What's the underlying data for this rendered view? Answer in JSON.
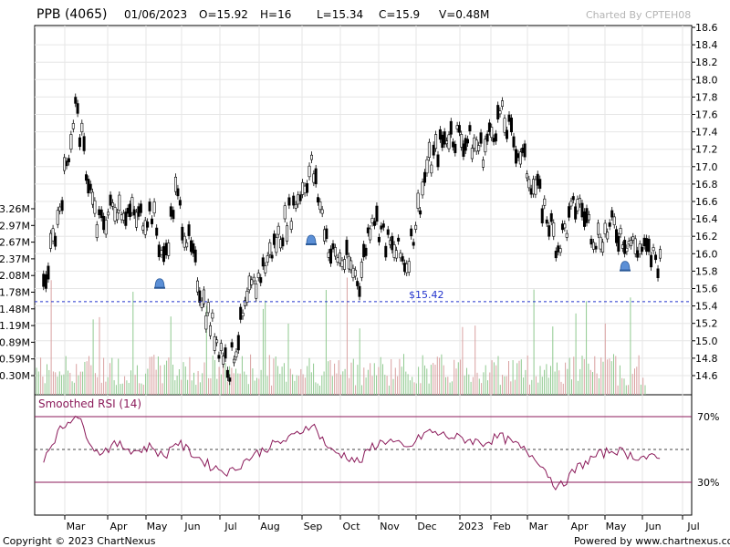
{
  "header": {
    "title": "PPB (4065)",
    "date": "01/06/2023",
    "open": "O=15.92",
    "high": "H=16",
    "low": "L=15.34",
    "close": "C=15.9",
    "volume": "V=0.48M",
    "credit": "Charted By CPTEH08"
  },
  "footer": {
    "copyright": "Copyright © 2023 ChartNexus",
    "powered": "Powered by www.chartnexus.com"
  },
  "colors": {
    "up_candle": "#ffffff",
    "down_candle": "#000000",
    "volume_up": "#8fc98f",
    "volume_down": "#d9a0a0",
    "rsi_line": "#8b1a5a",
    "rsi_bands": "#8b1a5a",
    "price_line": "#2233cc",
    "alert_icon": "#5b8fd6"
  },
  "chart_data": [
    {
      "type": "candlestick",
      "title": "PPB (4065)",
      "ylim": [
        14.4,
        18.6
      ],
      "y_ticks": [
        "18.6",
        "18.4",
        "18.2",
        "18.0",
        "17.8",
        "17.6",
        "17.4",
        "17.2",
        "17.0",
        "16.8",
        "16.6",
        "16.4",
        "16.2",
        "16.0",
        "15.8",
        "15.6",
        "15.4",
        "15.2",
        "15.0",
        "14.8",
        "14.6"
      ],
      "x_ticks": [
        "Mar",
        "Apr",
        "May",
        "Jun",
        "Jul",
        "Aug",
        "Sep",
        "Oct",
        "Nov",
        "Dec",
        "2023",
        "Feb",
        "Mar",
        "Apr",
        "May",
        "Jun",
        "Jul"
      ],
      "reference_line": {
        "label": "$15.42",
        "value": 15.45
      },
      "alerts": [
        {
          "month": "May",
          "price": 15.65
        },
        {
          "month": "Sep",
          "price": 16.15
        },
        {
          "month": "May",
          "price": 15.85
        }
      ],
      "close_path": [
        [
          "Feb",
          15.6
        ],
        [
          "Feb",
          16.4
        ],
        [
          "Mar",
          17.7
        ],
        [
          "Mar",
          16.3
        ],
        [
          "Apr",
          16.6
        ],
        [
          "Apr",
          16.4
        ],
        [
          "May",
          16.5
        ],
        [
          "May",
          15.9
        ],
        [
          "May",
          16.7
        ],
        [
          "Jun",
          16.0
        ],
        [
          "Jun",
          15.2
        ],
        [
          "Jul",
          14.7
        ],
        [
          "Jul",
          15.5
        ],
        [
          "Aug",
          16.0
        ],
        [
          "Aug",
          16.5
        ],
        [
          "Sep",
          17.0
        ],
        [
          "Sep",
          16.0
        ],
        [
          "Oct",
          15.9
        ],
        [
          "Oct",
          15.7
        ],
        [
          "Oct",
          16.5
        ],
        [
          "Nov",
          16.1
        ],
        [
          "Nov",
          15.9
        ],
        [
          "Dec",
          17.0
        ],
        [
          "Dec",
          17.4
        ],
        [
          "2023",
          17.3
        ],
        [
          "2023",
          17.2
        ],
        [
          "Feb",
          17.6
        ],
        [
          "Feb",
          17.2
        ],
        [
          "Mar",
          16.7
        ],
        [
          "Mar",
          16.1
        ],
        [
          "Apr",
          16.6
        ],
        [
          "Apr",
          16.2
        ],
        [
          "May",
          16.3
        ],
        [
          "May",
          16.1
        ],
        [
          "Jun",
          15.9
        ]
      ],
      "volume_axis": {
        "ticks": [
          "3.26M",
          "2.97M",
          "2.67M",
          "2.37M",
          "2.08M",
          "1.78M",
          "1.48M",
          "1.19M",
          "0.89M",
          "0.59M",
          "0.30M"
        ],
        "range_m": [
          0.0,
          3.26
        ]
      }
    },
    {
      "type": "line",
      "title": "Smoothed RSI (14)",
      "ylim": [
        0,
        100
      ],
      "levels": [
        {
          "label": "70%",
          "value": 70
        },
        {
          "label": "30%",
          "value": 30
        }
      ],
      "midline": 50,
      "path": [
        [
          "Feb",
          45
        ],
        [
          "Feb",
          60
        ],
        [
          "Mar",
          72
        ],
        [
          "Mar",
          48
        ],
        [
          "Apr",
          53
        ],
        [
          "Apr",
          49
        ],
        [
          "May",
          52
        ],
        [
          "May",
          45
        ],
        [
          "May",
          55
        ],
        [
          "Jun",
          48
        ],
        [
          "Jun",
          40
        ],
        [
          "Jul",
          36
        ],
        [
          "Jul",
          45
        ],
        [
          "Aug",
          52
        ],
        [
          "Aug",
          57
        ],
        [
          "Sep",
          66
        ],
        [
          "Sep",
          49
        ],
        [
          "Oct",
          46
        ],
        [
          "Oct",
          42
        ],
        [
          "Oct",
          52
        ],
        [
          "Nov",
          56
        ],
        [
          "Nov",
          50
        ],
        [
          "Dec",
          61
        ],
        [
          "Dec",
          58
        ],
        [
          "2023",
          56
        ],
        [
          "2023",
          54
        ],
        [
          "Feb",
          58
        ],
        [
          "Feb",
          52
        ],
        [
          "Mar",
          44
        ],
        [
          "Mar",
          26
        ],
        [
          "Apr",
          39
        ],
        [
          "Apr",
          46
        ],
        [
          "May",
          50
        ],
        [
          "May",
          46
        ],
        [
          "Jun",
          44
        ]
      ]
    }
  ]
}
